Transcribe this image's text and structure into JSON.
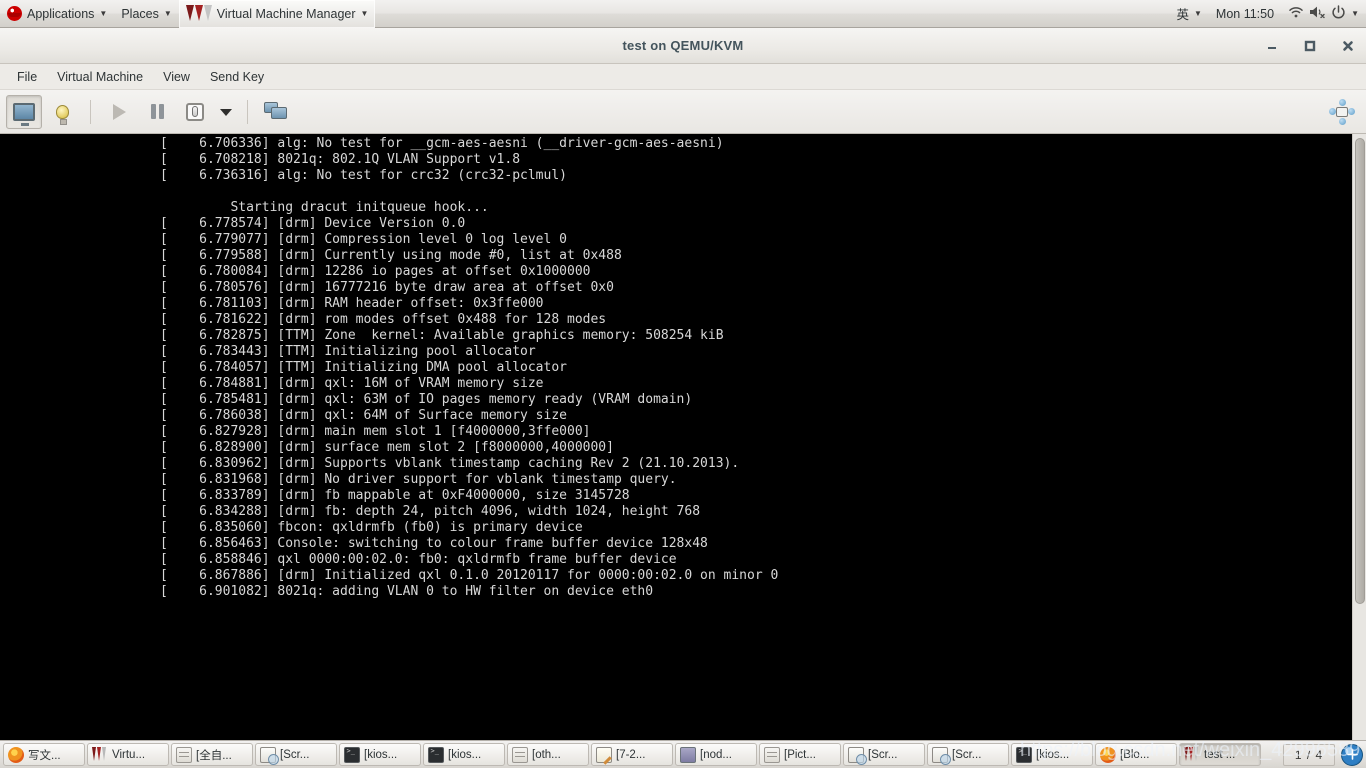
{
  "top_panel": {
    "redhat_icon": "redhat-logo-icon",
    "applications": "Applications",
    "places": "Places",
    "active_app": "Virtual Machine Manager",
    "input_method": "英",
    "clock": "Mon 11:50",
    "network_icon": "wifi-icon",
    "volume_icon": "volume-muted-icon",
    "power_icon": "power-icon",
    "caret": "▼"
  },
  "window": {
    "title": "test on QEMU/KVM",
    "minimize": "minimize-button",
    "maximize": "maximize-button",
    "close": "close-button"
  },
  "menubar": {
    "items": [
      {
        "label": "File"
      },
      {
        "label": "Virtual Machine"
      },
      {
        "label": "View"
      },
      {
        "label": "Send Key"
      }
    ]
  },
  "toolbar": {
    "console_view": "show-console",
    "details_view": "show-details",
    "run": "Run",
    "pause": "Pause",
    "shutdown": "Shut Down",
    "shutdown_menu": "▼",
    "snapshots": "Manage snapshots",
    "fullscreen": "Toggle fullscreen"
  },
  "console": {
    "lines": [
      "[    6.706336] alg: No test for __gcm-aes-aesni (__driver-gcm-aes-aesni)",
      "[    6.708218] 8021q: 802.1Q VLAN Support v1.8",
      "[    6.736316] alg: No test for crc32 (crc32-pclmul)",
      "",
      "         Starting dracut initqueue hook...",
      "[    6.778574] [drm] Device Version 0.0",
      "[    6.779077] [drm] Compression level 0 log level 0",
      "[    6.779588] [drm] Currently using mode #0, list at 0x488",
      "[    6.780084] [drm] 12286 io pages at offset 0x1000000",
      "[    6.780576] [drm] 16777216 byte draw area at offset 0x0",
      "[    6.781103] [drm] RAM header offset: 0x3ffe000",
      "[    6.781622] [drm] rom modes offset 0x488 for 128 modes",
      "[    6.782875] [TTM] Zone  kernel: Available graphics memory: 508254 kiB",
      "[    6.783443] [TTM] Initializing pool allocator",
      "[    6.784057] [TTM] Initializing DMA pool allocator",
      "[    6.784881] [drm] qxl: 16M of VRAM memory size",
      "[    6.785481] [drm] qxl: 63M of IO pages memory ready (VRAM domain)",
      "[    6.786038] [drm] qxl: 64M of Surface memory size",
      "[    6.827928] [drm] main mem slot 1 [f4000000,3ffe000]",
      "[    6.828900] [drm] surface mem slot 2 [f8000000,4000000]",
      "[    6.830962] [drm] Supports vblank timestamp caching Rev 2 (21.10.2013).",
      "[    6.831968] [drm] No driver support for vblank timestamp query.",
      "[    6.833789] [drm] fb mappable at 0xF4000000, size 3145728",
      "[    6.834288] [drm] fb: depth 24, pitch 4096, width 1024, height 768",
      "[    6.835060] fbcon: qxldrmfb (fb0) is primary device",
      "[    6.856463] Console: switching to colour frame buffer device 128x48",
      "[    6.858846] qxl 0000:00:02.0: fb0: qxldrmfb frame buffer device",
      "[    6.867886] [drm] Initialized qxl 0.1.0 20120117 for 0000:00:02.0 on minor 0",
      "[    6.901082] 8021q: adding VLAN 0 to HW filter on device eth0"
    ]
  },
  "taskbar": {
    "tasks": [
      {
        "label": "写文...",
        "icon": "firefox-icon",
        "current": false
      },
      {
        "label": "Virtu...",
        "icon": "vmm-icon",
        "current": false
      },
      {
        "label": "[全自...",
        "icon": "files-icon",
        "current": false
      },
      {
        "label": "[Scr...",
        "icon": "image-viewer-icon",
        "current": false
      },
      {
        "label": "[kios...",
        "icon": "terminal-icon",
        "current": false
      },
      {
        "label": "[kios...",
        "icon": "terminal-icon",
        "current": false
      },
      {
        "label": "[oth...",
        "icon": "files-icon",
        "current": false
      },
      {
        "label": "[7-2...",
        "icon": "notes-icon",
        "current": false
      },
      {
        "label": "[nod...",
        "icon": "screen-icon",
        "current": false
      },
      {
        "label": "[Pict...",
        "icon": "files-icon",
        "current": false
      },
      {
        "label": "[Scr...",
        "icon": "image-viewer-icon",
        "current": false
      },
      {
        "label": "[Scr...",
        "icon": "image-viewer-icon",
        "current": false
      },
      {
        "label": "[kios...",
        "icon": "terminal-icon",
        "current": false
      },
      {
        "label": "[Blo...",
        "icon": "firefox-icon",
        "current": false
      },
      {
        "label": "test ...",
        "icon": "vmm-icon",
        "current": true
      }
    ],
    "workspace": "1 / 4",
    "show_desktop": "show-desktop-button"
  },
  "watermark": "https://blog.csdn.net/weixin_42996589"
}
